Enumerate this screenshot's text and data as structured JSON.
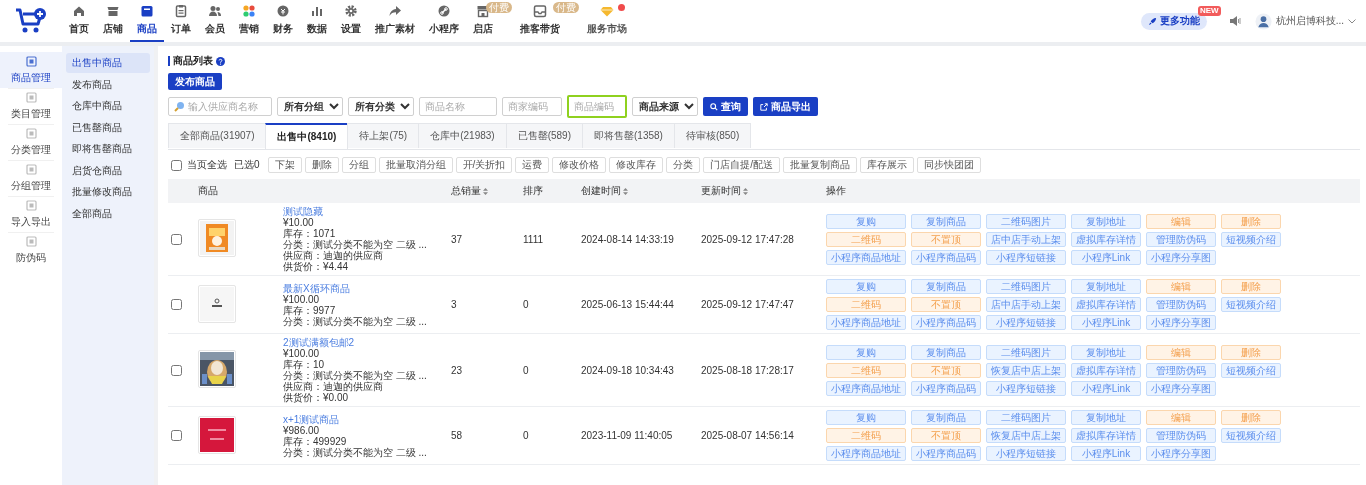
{
  "top_nav": {
    "items": [
      {
        "label": "首页",
        "selected": false
      },
      {
        "label": "店铺",
        "selected": false
      },
      {
        "label": "商品",
        "selected": true
      },
      {
        "label": "订单",
        "selected": false
      },
      {
        "label": "会员",
        "selected": false
      },
      {
        "label": "营销",
        "selected": false
      },
      {
        "label": "财务",
        "selected": false
      },
      {
        "label": "数据",
        "selected": false
      },
      {
        "label": "设置",
        "selected": false
      },
      {
        "label": "推广素材",
        "selected": false
      },
      {
        "label": "小程序",
        "selected": false
      },
      {
        "label": "启店",
        "selected": false,
        "badge": "付费"
      },
      {
        "label": "推客带货",
        "selected": false,
        "badge": "付费"
      },
      {
        "label": "服务市场",
        "selected": false,
        "dot": true
      }
    ],
    "more_button": "更多功能",
    "new_badge": "NEW",
    "account": "杭州启博科技..."
  },
  "side_nav": [
    {
      "label": "商品管理",
      "selected": true
    },
    {
      "label": "类目管理",
      "selected": false
    },
    {
      "label": "分类管理",
      "selected": false
    },
    {
      "label": "分组管理",
      "selected": false
    },
    {
      "label": "导入导出",
      "selected": false
    },
    {
      "label": "防伪码",
      "selected": false
    }
  ],
  "sub_nav": [
    {
      "label": "出售中商品",
      "selected": true
    },
    {
      "label": "发布商品",
      "selected": false
    },
    {
      "label": "仓库中商品",
      "selected": false
    },
    {
      "label": "已售罄商品",
      "selected": false
    },
    {
      "label": "即将售罄商品",
      "selected": false
    },
    {
      "label": "启货仓商品",
      "selected": false
    },
    {
      "label": "批量修改商品",
      "selected": false
    },
    {
      "label": "全部商品",
      "selected": false
    }
  ],
  "page_title": "商品列表",
  "publish_button": "发布商品",
  "filters": [
    {
      "kind": "search",
      "placeholder": "输入供应商名称"
    },
    {
      "kind": "select",
      "value": "所有分组"
    },
    {
      "kind": "select",
      "value": "所有分类"
    },
    {
      "kind": "input",
      "placeholder": "商品名称"
    },
    {
      "kind": "input",
      "placeholder": "商家编码"
    },
    {
      "kind": "input",
      "placeholder": "商品编码",
      "highlighted": true
    },
    {
      "kind": "select",
      "value": "商品来源"
    }
  ],
  "query_button": "查询",
  "export_button": "商品导出",
  "tabs": [
    {
      "label": "全部商品(31907)",
      "selected": false
    },
    {
      "label": "出售中(8410)",
      "selected": true
    },
    {
      "label": "待上架(75)",
      "selected": false
    },
    {
      "label": "仓库中(21983)",
      "selected": false
    },
    {
      "label": "已售罄(589)",
      "selected": false
    },
    {
      "label": "即将售罄(1358)",
      "selected": false
    },
    {
      "label": "待审核(850)",
      "selected": false
    }
  ],
  "select_all": {
    "label": "当页全选",
    "checked": false
  },
  "selected_count": "已选0",
  "batch_actions": [
    "下架",
    "删除",
    "分组",
    "批量取消分组",
    "开/关折扣",
    "运费",
    "修改价格",
    "修改库存",
    "分类",
    "门店自提/配送",
    "批量复制商品",
    "库存展示",
    "同步快团团"
  ],
  "table": {
    "columns": [
      {
        "label": "商品",
        "sortable": false
      },
      {
        "label": "总销量",
        "sortable": true
      },
      {
        "label": "排序",
        "sortable": false
      },
      {
        "label": "创建时间",
        "sortable": true
      },
      {
        "label": "更新时间",
        "sortable": true
      },
      {
        "label": "操作",
        "sortable": false
      }
    ],
    "rows": [
      {
        "checked": false,
        "name": "测试隐藏",
        "details": [
          "¥10.00",
          "库存：1071",
          "分类：测试分类不能为空 二级 ...",
          "供应商：迪迦的供应商",
          "供货价：¥4.44"
        ],
        "sales": "37",
        "sort": "1111",
        "created": "2024-08-14 14:33:19",
        "updated": "2025-09-12 17:47:28",
        "actions": [
          {
            "label": "复购",
            "kind": "primary"
          },
          {
            "label": "复制商品",
            "kind": "primary"
          },
          {
            "label": "二维码图片",
            "kind": "primary"
          },
          {
            "label": "复制地址",
            "kind": "primary"
          },
          {
            "label": "编辑",
            "kind": "warn"
          },
          {
            "label": "删除",
            "kind": "warn"
          },
          {
            "label": "二维码",
            "kind": "warn"
          },
          {
            "label": "不置顶",
            "kind": "warn"
          },
          {
            "label": "店中店手动上架",
            "kind": "primary"
          },
          {
            "label": "虚拟库存详情",
            "kind": "primary"
          },
          {
            "label": "管理防伪码",
            "kind": "primary"
          },
          {
            "label": "短视频介绍",
            "kind": "primary"
          },
          {
            "label": "小程序商品地址",
            "kind": "primary"
          },
          {
            "label": "小程序商品码",
            "kind": "primary"
          },
          {
            "label": "小程序短链接",
            "kind": "primary"
          },
          {
            "label": "小程序Link",
            "kind": "primary"
          },
          {
            "label": "小程序分享图",
            "kind": "primary"
          }
        ]
      },
      {
        "checked": false,
        "name": "最新X循环商品",
        "details": [
          "¥100.00",
          "库存：9977",
          "分类：测试分类不能为空 二级 ..."
        ],
        "sales": "3",
        "sort": "0",
        "created": "2025-06-13 15:44:44",
        "updated": "2025-09-12 17:47:47",
        "actions": [
          {
            "label": "复购",
            "kind": "primary"
          },
          {
            "label": "复制商品",
            "kind": "primary"
          },
          {
            "label": "二维码图片",
            "kind": "primary"
          },
          {
            "label": "复制地址",
            "kind": "primary"
          },
          {
            "label": "编辑",
            "kind": "warn"
          },
          {
            "label": "删除",
            "kind": "warn"
          },
          {
            "label": "二维码",
            "kind": "warn"
          },
          {
            "label": "不置顶",
            "kind": "warn"
          },
          {
            "label": "店中店手动上架",
            "kind": "primary"
          },
          {
            "label": "虚拟库存详情",
            "kind": "primary"
          },
          {
            "label": "管理防伪码",
            "kind": "primary"
          },
          {
            "label": "短视频介绍",
            "kind": "primary"
          },
          {
            "label": "小程序商品地址",
            "kind": "primary"
          },
          {
            "label": "小程序商品码",
            "kind": "primary"
          },
          {
            "label": "小程序短链接",
            "kind": "primary"
          },
          {
            "label": "小程序Link",
            "kind": "primary"
          },
          {
            "label": "小程序分享图",
            "kind": "primary"
          }
        ]
      },
      {
        "checked": false,
        "name": "2测试满额包邮2",
        "details": [
          "¥100.00",
          "库存：10",
          "分类：测试分类不能为空 二级 ...",
          "供应商：迪迦的供应商",
          "供货价：¥0.00"
        ],
        "sales": "23",
        "sort": "0",
        "created": "2024-09-18 10:34:43",
        "updated": "2025-08-18 17:28:17",
        "actions": [
          {
            "label": "复购",
            "kind": "primary"
          },
          {
            "label": "复制商品",
            "kind": "primary"
          },
          {
            "label": "二维码图片",
            "kind": "primary"
          },
          {
            "label": "复制地址",
            "kind": "primary"
          },
          {
            "label": "编辑",
            "kind": "warn"
          },
          {
            "label": "删除",
            "kind": "warn"
          },
          {
            "label": "二维码",
            "kind": "warn"
          },
          {
            "label": "不置顶",
            "kind": "warn"
          },
          {
            "label": "恢复店中店上架",
            "kind": "primary"
          },
          {
            "label": "虚拟库存详情",
            "kind": "primary"
          },
          {
            "label": "管理防伪码",
            "kind": "primary"
          },
          {
            "label": "短视频介绍",
            "kind": "primary"
          },
          {
            "label": "小程序商品地址",
            "kind": "primary"
          },
          {
            "label": "小程序商品码",
            "kind": "primary"
          },
          {
            "label": "小程序短链接",
            "kind": "primary"
          },
          {
            "label": "小程序Link",
            "kind": "primary"
          },
          {
            "label": "小程序分享图",
            "kind": "primary"
          }
        ]
      },
      {
        "checked": false,
        "name": "x+1测试商品",
        "details": [
          "¥986.00",
          "库存：499929",
          "分类：测试分类不能为空 二级 ..."
        ],
        "sales": "58",
        "sort": "0",
        "created": "2023-11-09 11:40:05",
        "updated": "2025-08-07 14:56:14",
        "actions": [
          {
            "label": "复购",
            "kind": "primary"
          },
          {
            "label": "复制商品",
            "kind": "primary"
          },
          {
            "label": "二维码图片",
            "kind": "primary"
          },
          {
            "label": "复制地址",
            "kind": "primary"
          },
          {
            "label": "编辑",
            "kind": "warn"
          },
          {
            "label": "删除",
            "kind": "warn"
          },
          {
            "label": "二维码",
            "kind": "warn"
          },
          {
            "label": "不置顶",
            "kind": "warn"
          },
          {
            "label": "恢复店中店上架",
            "kind": "primary"
          },
          {
            "label": "虚拟库存详情",
            "kind": "primary"
          },
          {
            "label": "管理防伪码",
            "kind": "primary"
          },
          {
            "label": "短视频介绍",
            "kind": "primary"
          },
          {
            "label": "小程序商品地址",
            "kind": "primary"
          },
          {
            "label": "小程序商品码",
            "kind": "primary"
          },
          {
            "label": "小程序短链接",
            "kind": "primary"
          },
          {
            "label": "小程序Link",
            "kind": "primary"
          },
          {
            "label": "小程序分享图",
            "kind": "primary"
          }
        ]
      }
    ]
  }
}
